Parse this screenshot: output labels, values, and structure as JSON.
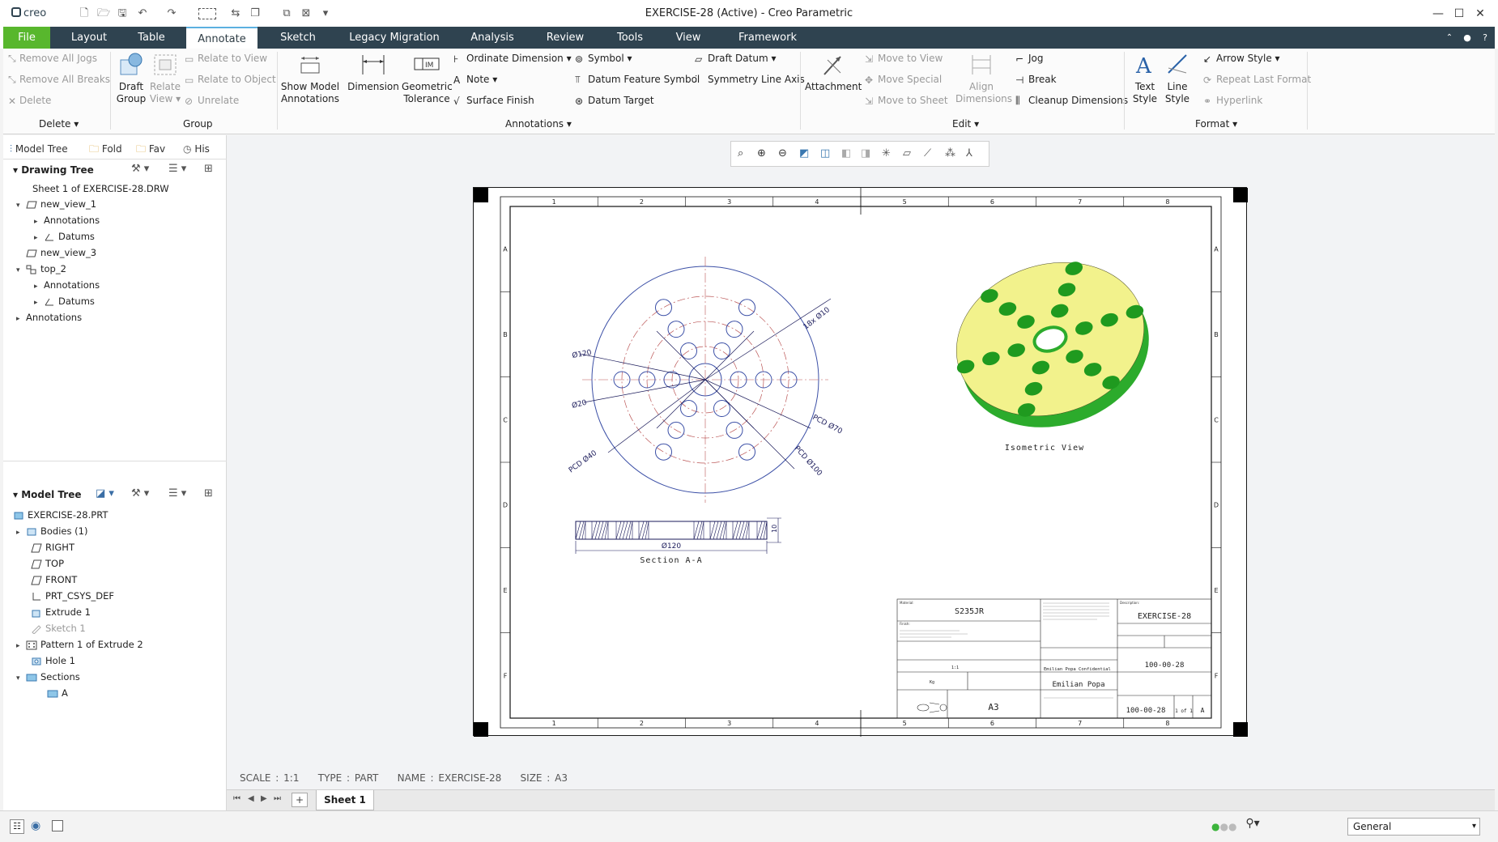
{
  "app": {
    "logo": "creo",
    "title": "EXERCISE-28 (Active) - Creo Parametric"
  },
  "quick_access": [
    "new-icon",
    "open-icon",
    "save-icon",
    "undo-icon",
    "redo-icon",
    "select-icon",
    "regenerate-icon",
    "windows-icon",
    "close-window-icon",
    "customize-icon"
  ],
  "tabs": [
    {
      "label": "File"
    },
    {
      "label": "Layout"
    },
    {
      "label": "Table"
    },
    {
      "label": "Annotate"
    },
    {
      "label": "Sketch"
    },
    {
      "label": "Legacy Migration"
    },
    {
      "label": "Analysis"
    },
    {
      "label": "Review"
    },
    {
      "label": "Tools"
    },
    {
      "label": "View"
    },
    {
      "label": "Framework"
    }
  ],
  "ribbon": {
    "delete": {
      "remove_jogs": "Remove All Jogs",
      "remove_breaks": "Remove All Breaks",
      "delete": "Delete",
      "group_label": "Delete"
    },
    "group": {
      "draft_group": [
        "Draft",
        "Group"
      ],
      "relate_view": [
        "Relate",
        "View"
      ],
      "relate_to_view": "Relate to View",
      "relate_to_object": "Relate to Object",
      "unrelate": "Unrelate",
      "group_label": "Group"
    },
    "show_model": [
      "Show Model",
      "Annotations"
    ],
    "annotations": {
      "dimension": "Dimension",
      "geom_tol": [
        "Geometric",
        "Tolerance"
      ],
      "ordinate": "Ordinate Dimension",
      "note": "Note",
      "surface_finish": "Surface Finish",
      "symbol": "Symbol",
      "datum_feature": "Datum Feature Symbol",
      "datum_target": "Datum Target",
      "draft_datum": "Draft Datum",
      "symmetry": "Symmetry Line Axis",
      "group_label": "Annotations"
    },
    "edit": {
      "attachment": "Attachment",
      "move_view": "Move to View",
      "move_special": "Move Special",
      "move_sheet": "Move to Sheet",
      "align": [
        "Align",
        "Dimensions"
      ],
      "jog": "Jog",
      "break": "Break",
      "cleanup": "Cleanup Dimensions",
      "group_label": "Edit"
    },
    "format": {
      "text_style": [
        "Text",
        "Style"
      ],
      "line_style": [
        "Line",
        "Style"
      ],
      "arrow_style": "Arrow Style",
      "repeat": "Repeat Last Format",
      "hyperlink": "Hyperlink",
      "group_label": "Format"
    }
  },
  "panel_tabs": [
    "Model Tree",
    "Fold",
    "Fav",
    "His"
  ],
  "drawing_tree": {
    "title": "Drawing Tree",
    "items": [
      {
        "label": "Sheet 1 of EXERCISE-28.DRW"
      },
      {
        "label": "new_view_1"
      },
      {
        "label": "Annotations"
      },
      {
        "label": "Datums"
      },
      {
        "label": "new_view_3"
      },
      {
        "label": "top_2"
      },
      {
        "label": "Annotations"
      },
      {
        "label": "Datums"
      },
      {
        "label": "Annotations"
      }
    ]
  },
  "model_tree": {
    "title": "Model Tree",
    "items": [
      {
        "label": "EXERCISE-28.PRT"
      },
      {
        "label": "Bodies (1)"
      },
      {
        "label": "RIGHT"
      },
      {
        "label": "TOP"
      },
      {
        "label": "FRONT"
      },
      {
        "label": "PRT_CSYS_DEF"
      },
      {
        "label": "Extrude 1"
      },
      {
        "label": "Sketch 1"
      },
      {
        "label": "Pattern 1 of Extrude 2"
      },
      {
        "label": "Hole 1"
      },
      {
        "label": "Sections"
      },
      {
        "label": "A"
      }
    ]
  },
  "drawing": {
    "col_labels": [
      "1",
      "2",
      "3",
      "4",
      "5",
      "6",
      "7",
      "8"
    ],
    "row_labels": [
      "A",
      "B",
      "C",
      "D",
      "E",
      "F"
    ],
    "dims": {
      "d120": "Ø120",
      "d20": "Ø20",
      "pcd40": "PCD Ø40",
      "holes": "18x Ø10",
      "pcd70": "PCD Ø70",
      "pcd100": "PCD Ø100",
      "sec_dim": "Ø120",
      "sec_thk": "10"
    },
    "isometric_label": "Isometric View",
    "section_label": "Section A-A",
    "title_block": {
      "material_lbl": "Material:",
      "material": "S235JR",
      "finish_lbl": "Finish:",
      "description_lbl": "Description:",
      "description": "EXERCISE-28",
      "company": "Emilian Popa Confidential",
      "owner": "Emilian Popa",
      "scale": "1:1",
      "sheet_size": "A3",
      "part_number": "100-00-28",
      "drawing_number": "100-00-28",
      "sheet": "1 of 1",
      "revision": "A",
      "weight": "Kg"
    }
  },
  "info_bar": {
    "scale": "SCALE : 1:1",
    "type": "TYPE : PART",
    "name": "NAME : EXERCISE-28",
    "size": "SIZE : A3"
  },
  "sheet_tab": "Sheet 1",
  "status": {
    "filter": "General"
  },
  "colors": {
    "accent": "#58b72d",
    "tabbar": "#2f4350",
    "part_face": "#f0f08a",
    "part_side": "#2db52d"
  }
}
